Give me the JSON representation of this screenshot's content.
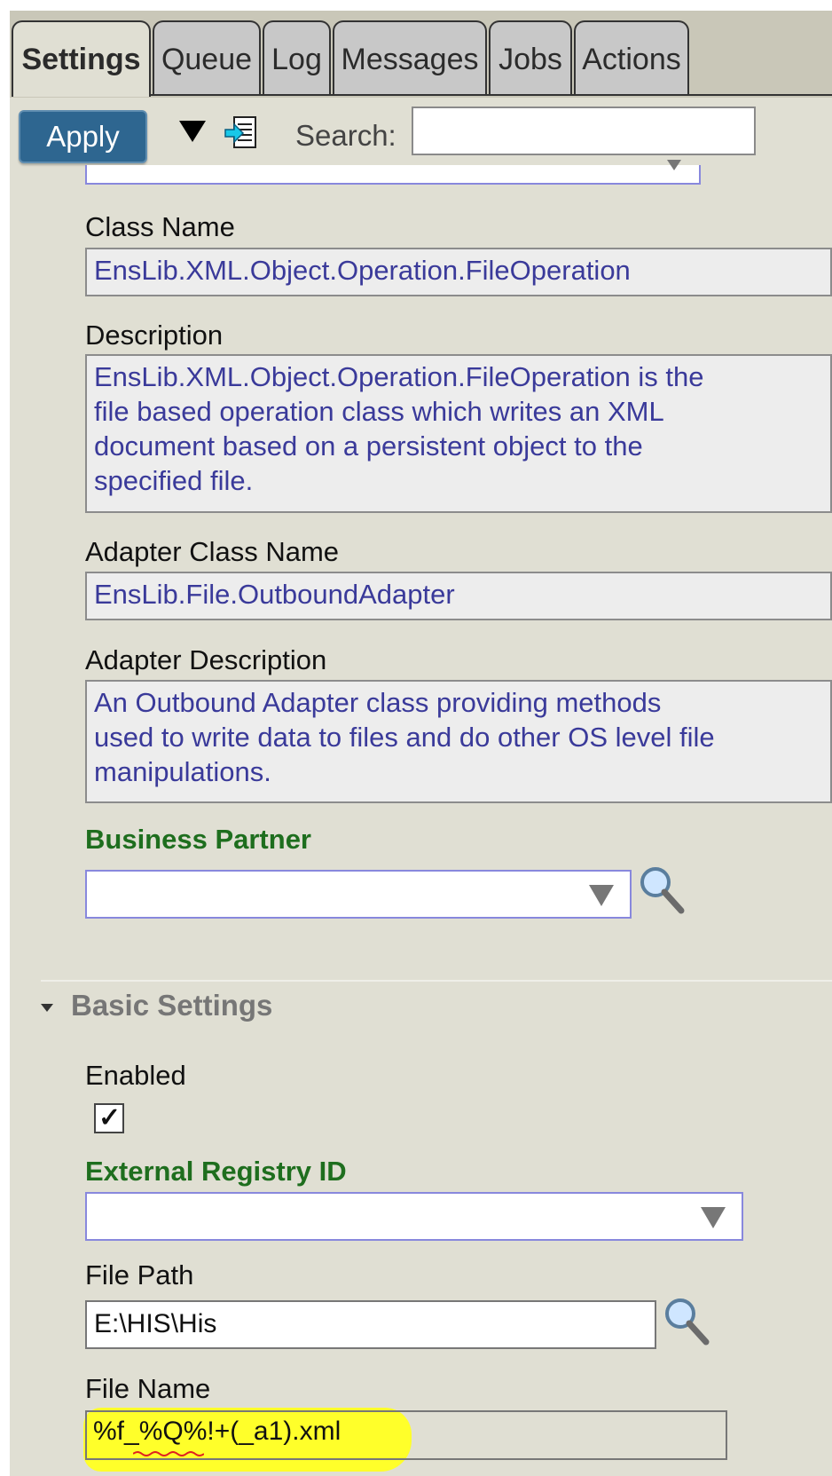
{
  "tabs": [
    {
      "label": "Settings",
      "active": true
    },
    {
      "label": "Queue"
    },
    {
      "label": "Log"
    },
    {
      "label": "Messages"
    },
    {
      "label": "Jobs"
    },
    {
      "label": "Actions"
    }
  ],
  "toolbar": {
    "apply_label": "Apply",
    "search_label": "Search:",
    "search_value": "",
    "icons": [
      "dropdown-triangle-icon",
      "document-export-icon"
    ]
  },
  "fields": {
    "class_name": {
      "label": "Class Name",
      "value": "EnsLib.XML.Object.Operation.FileOperation"
    },
    "description": {
      "label": "Description",
      "value": "EnsLib.XML.Object.Operation.FileOperation is the\nfile based operation class which writes an XML\ndocument based on a persistent object to the\nspecified file."
    },
    "adapter_class_name": {
      "label": "Adapter Class Name",
      "value": "EnsLib.File.OutboundAdapter"
    },
    "adapter_description": {
      "label": "Adapter Description",
      "value": "An Outbound Adapter class providing methods\nused to write data to files and do other OS level file\nmanipulations."
    },
    "business_partner": {
      "label": "Business Partner",
      "value": ""
    }
  },
  "basic_settings": {
    "title": "Basic Settings",
    "enabled": {
      "label": "Enabled",
      "checked": true,
      "mark": "✓"
    },
    "external_registry_id": {
      "label": "External Registry ID",
      "value": ""
    },
    "file_path": {
      "label": "File Path",
      "value": "E:\\HIS\\His"
    },
    "file_name": {
      "label": "File Name",
      "value": "%f_%Q%!+(_a1).xml"
    }
  },
  "colors": {
    "apply_button": "#2e6690",
    "required_label": "#1e6e1e",
    "readonly_text": "#3a3a9a",
    "panel_background": "#e0dfd3",
    "highlight": "#ffff2a"
  }
}
